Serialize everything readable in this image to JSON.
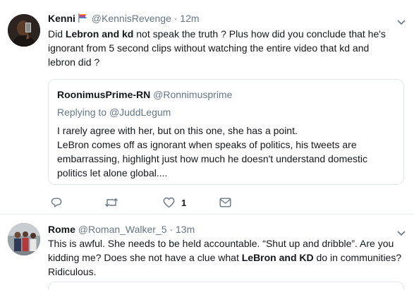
{
  "tweets": [
    {
      "name": "Kenni",
      "handle": "@KennisRevenge",
      "dot": "·",
      "time": "12m",
      "text_lines": [
        [
          "Did ",
          "Lebron and kd",
          " not speak the truth ? Plus how did you conclude that he's"
        ],
        [
          "ignorant from 5 second clips without watching the entire video that kd and"
        ],
        [
          "lebron did ?"
        ]
      ],
      "quote": {
        "name": "RoonimusPrime-RN",
        "handle": "@Ronnimusprime",
        "replying_prefix": "Replying to ",
        "replying_to": "@JuddLegum",
        "lines": [
          "I rarely agree with her, but on this one,  she has a point.",
          "LeBron comes off as ignorant when speaks of politics, his tweets are",
          "embarrassing, highlight just how much he doesn't understand domestic",
          "politics let alone global...."
        ]
      },
      "actions": {
        "reply_icon": "reply-icon",
        "retweet_icon": "retweet-icon",
        "like_icon": "heart-icon",
        "like_count": "1",
        "dm_icon": "envelope-icon"
      }
    },
    {
      "name": "Rome",
      "handle": "@Roman_Walker_5",
      "dot": "·",
      "time": "13m",
      "text_lines": [
        [
          "This is awful. She needs to be held accountable. “Shut up and dribble”. Are you"
        ],
        [
          "kidding me? Does she not have a clue what ",
          "LeBron and KD",
          " do in communities?"
        ],
        [
          "Ridiculous."
        ]
      ]
    }
  ],
  "colors": {
    "text": "#14171a",
    "secondary": "#657786",
    "border": "#e1e8ed"
  }
}
